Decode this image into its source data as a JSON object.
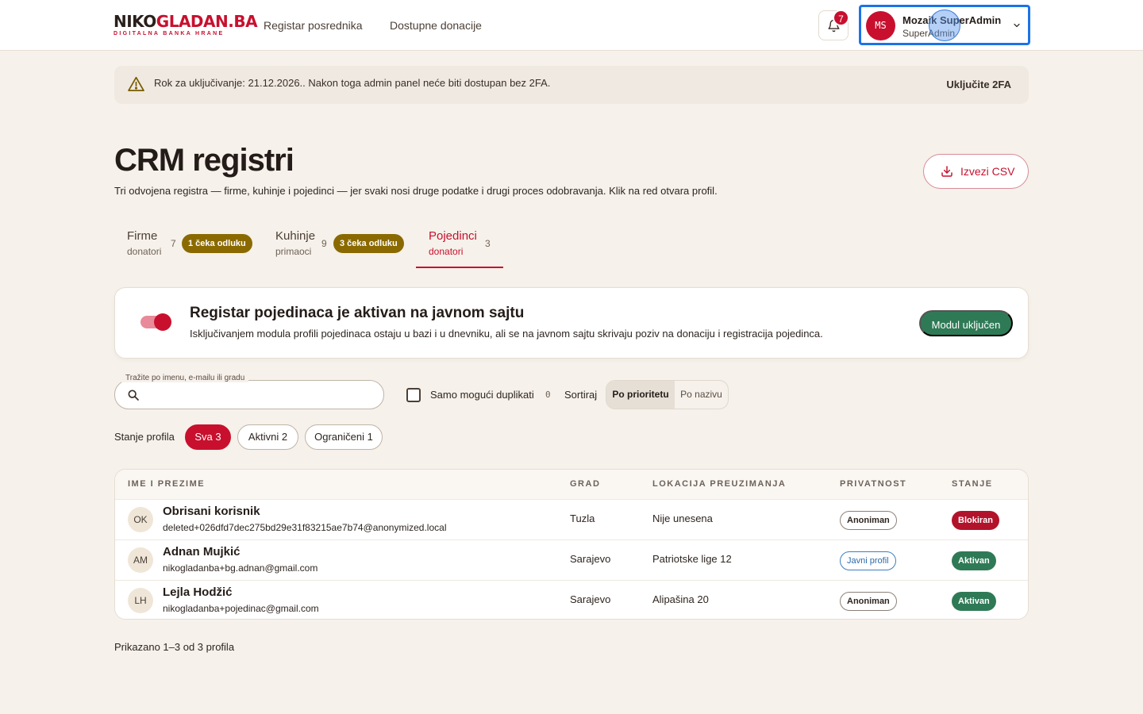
{
  "header": {
    "logo_dark": "NIKO",
    "logo_red": "GLADAN.BA",
    "logo_tagline": "DIGITALNA BANKA HRANE",
    "nav": [
      "Registar posrednika",
      "Dostupne donacije"
    ],
    "notifications_count": "7",
    "user_initials": "MS",
    "user_name": "Mozaik SuperAdmin",
    "user_role": "SuperAdmin",
    "icons": {
      "bell": "bell-icon",
      "chevron": "chevron-down-icon"
    }
  },
  "banner": {
    "text": "Rok za uključivanje: 21.12.2026.. Nakon toga admin panel neće biti dostupan bez 2FA.",
    "action": "Uključite 2FA",
    "icon": "warning-icon"
  },
  "page": {
    "title": "CRM registri",
    "subtitle": "Tri odvojena registra — firme, kuhinje i pojedinci — jer svaki nosi druge podatke i drugi proces odobravanja. Klik na red otvara profil.",
    "export_label": "Izvezi CSV"
  },
  "tabs": [
    {
      "title": "Firme",
      "sub": "donatori",
      "count": "7",
      "badge": "1 čeka odluku"
    },
    {
      "title": "Kuhinje",
      "sub": "primaoci",
      "count": "9",
      "badge": "3 čeka odluku"
    },
    {
      "title": "Pojedinci",
      "sub": "donatori",
      "count": "3",
      "active": true
    }
  ],
  "module": {
    "title": "Registar pojedinaca je aktivan na javnom sajtu",
    "description": "Isključivanjem modula profili pojedinaca ostaju u bazi i u dnevniku, ali se na javnom sajtu skrivaju poziv na donaciju i registracija pojedinca.",
    "toggle_on": true,
    "button": "Modul uključen"
  },
  "filters": {
    "search_legend": "Tražite po imenu, e-mailu ili gradu",
    "search_value": "",
    "duplicates_label": "Samo mogući duplikati",
    "duplicates_count": "0",
    "sort_label": "Sortiraj",
    "sort_options": [
      "Po prioritetu",
      "Po nazivu"
    ],
    "state_label": "Stanje profila",
    "state_chips": [
      "Sva 3",
      "Aktivni 2",
      "Ograničeni 1"
    ]
  },
  "table": {
    "columns": [
      "IME I PREZIME",
      "GRAD",
      "LOKACIJA PREUZIMANJA",
      "PRIVATNOST",
      "STANJE"
    ],
    "rows": [
      {
        "initials": "OK",
        "name": "Obrisani korisnik",
        "email": "deleted+026dfd7dec275bd29e31f83215ae7b74@anonymized.local",
        "city": "Tuzla",
        "location": "Nije unesena",
        "privacy": "Anoniman",
        "status": "Blokiran",
        "status_color": "#b3122b"
      },
      {
        "initials": "AM",
        "name": "Adnan Mujkić",
        "email": "nikogladanba+bg.adnan@gmail.com",
        "city": "Sarajevo",
        "location": "Patriotske lige 12",
        "privacy": "Javni profil",
        "status": "Aktivan",
        "status_color": "#2f7a56"
      },
      {
        "initials": "LH",
        "name": "Lejla Hodžić",
        "email": "nikogladanba+pojedinac@gmail.com",
        "city": "Sarajevo",
        "location": "Alipašina 20",
        "privacy": "Anoniman",
        "status": "Aktivan",
        "status_color": "#2f7a56"
      }
    ]
  },
  "footer": {
    "count_text": "Prikazano 1–3 od 3 profila"
  }
}
